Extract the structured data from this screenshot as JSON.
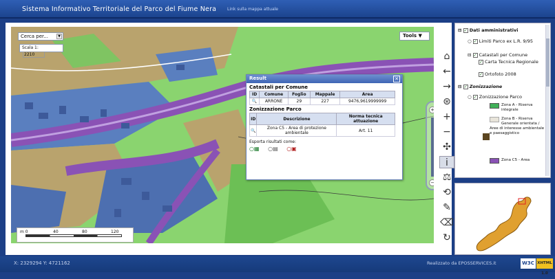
{
  "header": {
    "title": "Sistema Informativo Territoriale del Parco del Fiume Nera",
    "subtitle": "Link sulla mappa attuale"
  },
  "map": {
    "search_combo": "Cerca per...",
    "scale_label": "Scala 1:",
    "scale_value": "2210",
    "tools_label": "Tools",
    "scalebar_labels": [
      "m 0",
      "40",
      "80",
      "120"
    ]
  },
  "result": {
    "title": "Result",
    "section1": "Catastali per Comune",
    "section1_headers": [
      "ID",
      "Comune",
      "Foglio",
      "Mappale",
      "Area"
    ],
    "section1_row": [
      "",
      "ARRONE",
      "29",
      "227",
      "9476,9619999999"
    ],
    "section2": "Zonizzazione Parco",
    "section2_headers": [
      "ID",
      "Descrizione",
      "Norma tecnica attuazione"
    ],
    "section2_row": [
      "",
      "Zona C5 - Area di protezione ambientale",
      "Art. 11"
    ],
    "export_label": "Esporta risultati come:"
  },
  "layers": {
    "group1": "Dati amministrativi",
    "items1": [
      "Limiti Parco ex L.R. 9/95",
      "Catastali per Comune",
      "Carta Tecnica Regionale",
      "Ortofoto 2008"
    ],
    "group2": "Zonizzazione",
    "items2": [
      "Zonizzazione Parco"
    ],
    "legend": [
      {
        "label": "Zona A - Riserva integrale",
        "color": "#40b058"
      },
      {
        "label": "Zona B - Riserva Generale orientata / Aree di interesse ambientale e paesaggistico",
        "color": "#5b4520"
      },
      {
        "label": "Zona C5 - Area",
        "color": "#8a52b5"
      }
    ]
  },
  "footer": {
    "coords": "X: 2329294   Y: 4721162",
    "credit": "Realizzato da EPOSSERVICES.it",
    "badge1": "W3C",
    "badge2": "XHTML 1.0"
  },
  "colors": {
    "header": "#2f5fb5",
    "zone_green": "#8ad46f",
    "zone_blue": "#4b6fb0",
    "zone_purple": "#8a52b5",
    "zone_brown": "#b38a4a"
  }
}
